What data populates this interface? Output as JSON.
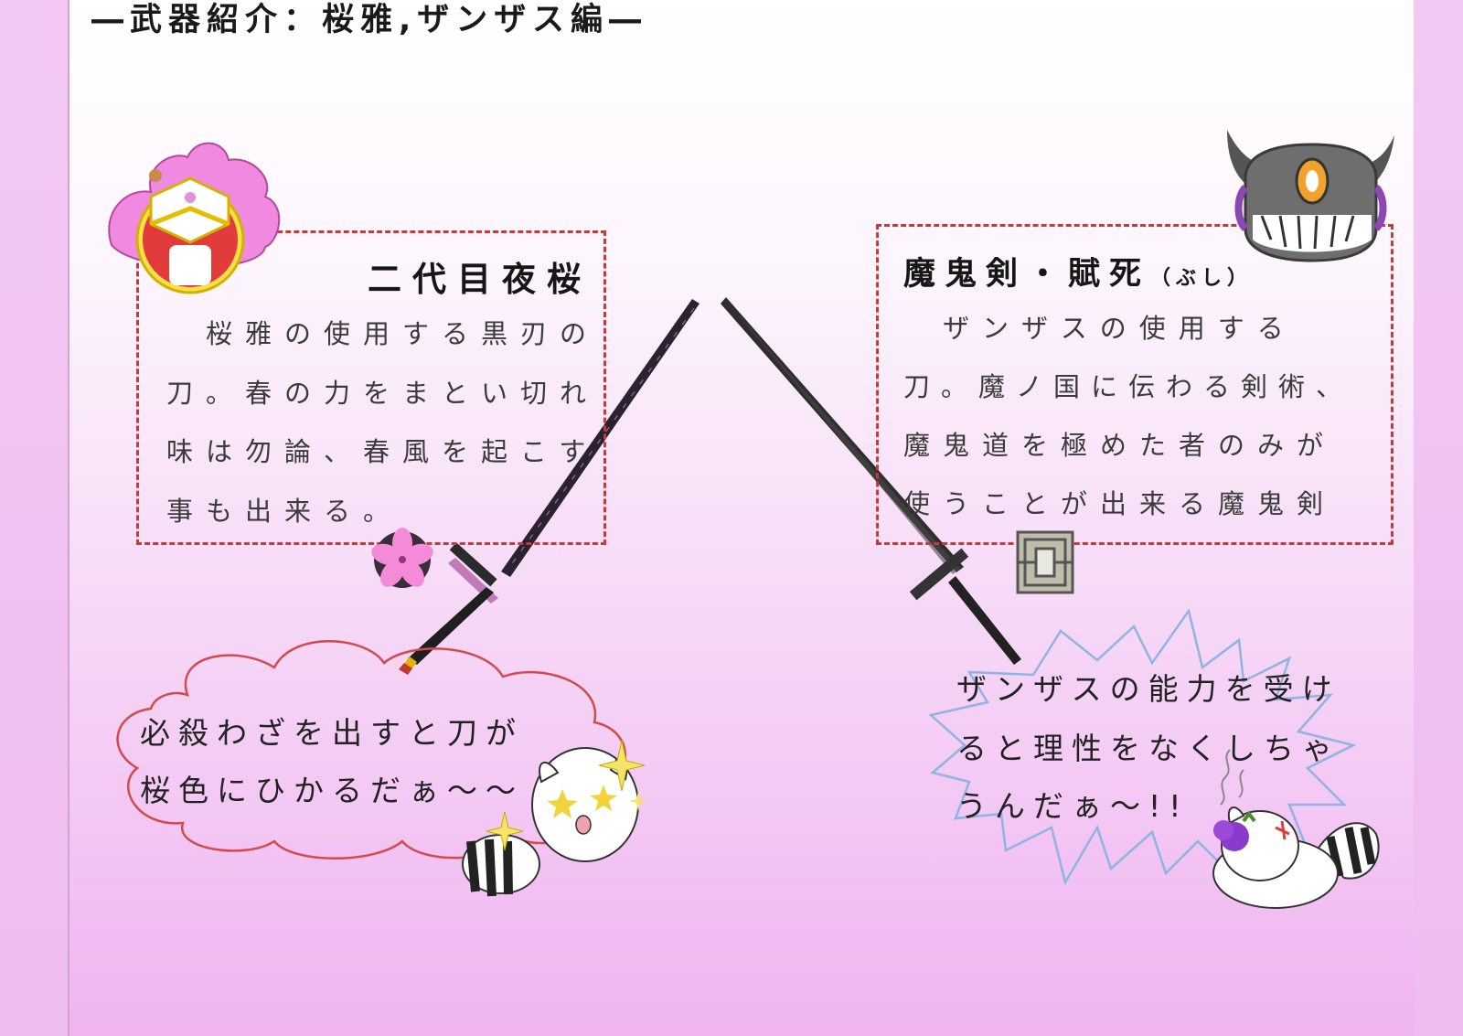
{
  "title": "―武器紹介：桜雅,ザンザス編―",
  "left_weapon": {
    "name": "二代目夜桜",
    "description_lines": [
      "　桜雅の使用する黒刃の",
      "刀。春の力をまとい切れ",
      "味は勿論、春風を起こす",
      "事も出来る。"
    ],
    "comment_lines": [
      "必殺わざを出すと刀が",
      "桜色にひかるだぁ～～"
    ]
  },
  "right_weapon": {
    "name": "魔鬼剣・賦死",
    "reading": "（ぶし）",
    "description_lines": [
      "　ザンザスの使用する",
      "刀。魔ノ国に伝わる剣術、",
      "魔鬼道を極めた者のみが",
      "使うことが出来る魔鬼剣"
    ],
    "comment_lines": [
      "ザンザスの能力を受け",
      "ると理性をなくしちゃ",
      "うんだぁ～!!"
    ]
  },
  "colors": {
    "box_border": "#c83a3a",
    "cloud_border": "#d24a4a",
    "burst_border": "#8fb3e3",
    "sakura_pink": "#ef80d6",
    "blade_dark": "#2b2b2b"
  },
  "icons": {
    "left_mascot": "sakura-helmet-mascot-icon",
    "right_mascot": "horned-helmet-mascot-icon",
    "sakura_emblem": "sakura-flower-icon",
    "kanji_emblem": "square-crest-icon",
    "happy_mascot": "raccoon-sparkle-mascot-icon",
    "angry_mascot": "raccoon-angry-mascot-icon"
  }
}
